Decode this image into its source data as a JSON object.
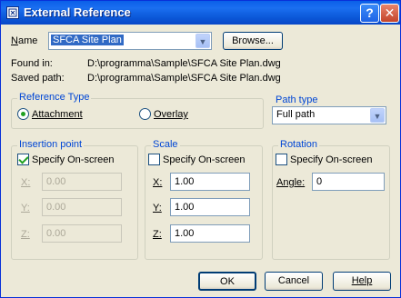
{
  "window": {
    "title": "External Reference",
    "help_glyph": "?",
    "close_glyph": "✕"
  },
  "name": {
    "label": "Name",
    "value": "SFCA Site Plan",
    "browse_label": "Browse..."
  },
  "paths": {
    "found_in_label": "Found in:",
    "found_in_value": "D:\\programma\\Sample\\SFCA Site Plan.dwg",
    "saved_path_label": "Saved path:",
    "saved_path_value": "D:\\programma\\Sample\\SFCA Site Plan.dwg"
  },
  "reference_type": {
    "title": "Reference Type",
    "attachment_label": "Attachment",
    "overlay_label": "Overlay",
    "selected": "Attachment"
  },
  "path_type": {
    "title": "Path type",
    "value": "Full path"
  },
  "insertion_point": {
    "title": "Insertion point",
    "specify_label": "Specify On-screen",
    "specify_checked": true,
    "x_label": "X:",
    "x_value": "0.00",
    "y_label": "Y:",
    "y_value": "0.00",
    "z_label": "Z:",
    "z_value": "0.00"
  },
  "scale": {
    "title": "Scale",
    "specify_label": "Specify On-screen",
    "specify_checked": false,
    "x_label": "X:",
    "x_value": "1.00",
    "y_label": "Y:",
    "y_value": "1.00",
    "z_label": "Z:",
    "z_value": "1.00"
  },
  "rotation": {
    "title": "Rotation",
    "specify_label": "Specify On-screen",
    "specify_checked": false,
    "angle_label": "Angle:",
    "angle_value": "0"
  },
  "buttons": {
    "ok": "OK",
    "cancel": "Cancel",
    "help": "Help"
  },
  "colors": {
    "titlebar": "#0a5fe8",
    "dialog_bg": "#ece9d8",
    "group_title": "#0046d5",
    "check_mark": "#21a121"
  }
}
